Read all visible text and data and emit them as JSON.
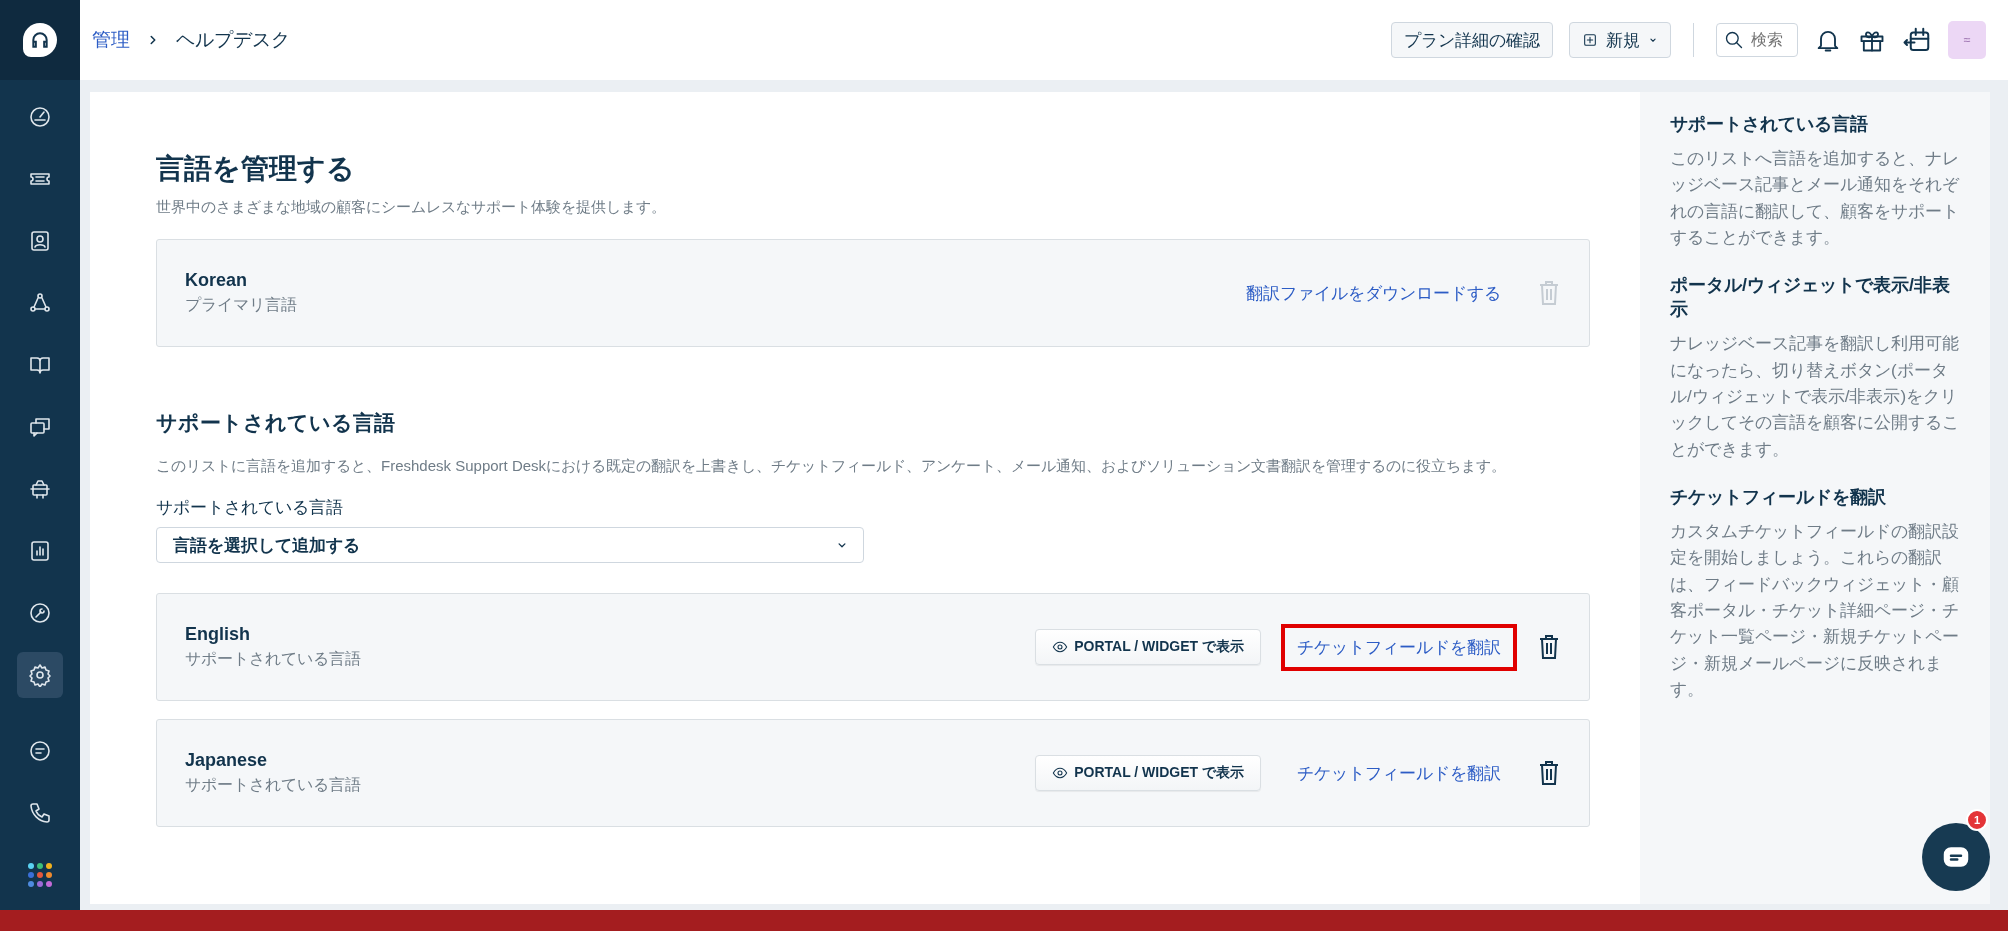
{
  "sidebar": {
    "items": [
      {
        "kind": "gauge",
        "selected": false
      },
      {
        "kind": "ticket",
        "selected": false
      },
      {
        "kind": "contact",
        "selected": false
      },
      {
        "kind": "network",
        "selected": false
      },
      {
        "kind": "book",
        "selected": false
      },
      {
        "kind": "bubbles",
        "selected": false
      },
      {
        "kind": "bot",
        "selected": false
      },
      {
        "kind": "chart",
        "selected": false
      },
      {
        "kind": "wrench",
        "selected": false
      },
      {
        "kind": "gear",
        "selected": true
      }
    ],
    "bottom_items": [
      {
        "kind": "message",
        "selected": false
      },
      {
        "kind": "phone",
        "selected": false
      },
      {
        "kind": "apps",
        "selected": false
      }
    ]
  },
  "breadcrumb": {
    "parent": "管理",
    "current": "ヘルプデスク"
  },
  "header": {
    "plan_button": "プラン詳細の確認",
    "new_button": "新規",
    "search": {
      "placeholder": "検索"
    }
  },
  "page": {
    "title": "言語を管理する",
    "subtitle": "世界中のさまざまな地域の顧客にシームレスなサポート体験を提供します。",
    "primary_language": {
      "name": "Korean",
      "caption": "プライマリ言語",
      "link": "翻訳ファイルをダウンロードする",
      "delete_disabled": true
    },
    "supported": {
      "heading": "サポートされている言語",
      "description": "このリストに言語を追加すると、Freshdesk Support Deskにおける既定の翻訳を上書きし、チケットフィールド、アンケート、メール通知、およびソリューション文書翻訳を管理するのに役立ちます。",
      "select_label": "サポートされている言語",
      "select_value": "言語を選択して追加する",
      "languages": [
        {
          "name": "English",
          "caption": "サポートされている言語",
          "portal_button": "PORTAL / WIDGET で表示",
          "translate_link": "チケットフィールドを翻訳",
          "highlighted": true,
          "delete_disabled": false
        },
        {
          "name": "Japanese",
          "caption": "サポートされている言語",
          "portal_button": "PORTAL / WIDGET で表示",
          "translate_link": "チケットフィールドを翻訳",
          "highlighted": false,
          "delete_disabled": false
        }
      ]
    }
  },
  "help_panel": {
    "sections": [
      {
        "heading": "サポートされている言語",
        "text": "このリストへ言語を追加すると、ナレッジベース記事とメール通知をそれぞれの言語に翻訳して、顧客をサポートすることができます。"
      },
      {
        "heading": "ポータル/ウィジェットで表示/非表示",
        "text": "ナレッジベース記事を翻訳し利用可能になったら、切り替えボタン(ポータル/ウィジェットで表示/非表示)をクリックしてその言語を顧客に公開することができます。"
      },
      {
        "heading": "チケットフィールドを翻訳",
        "text": "カスタムチケットフィールドの翻訳設定を開始しましょう。これらの翻訳は、フィードバックウィジェット・顧客ポータル・チケット詳細ページ・チケット一覧ページ・新規チケットページ・新規メールページに反映されます。"
      }
    ]
  },
  "chat": {
    "badge": "1"
  }
}
